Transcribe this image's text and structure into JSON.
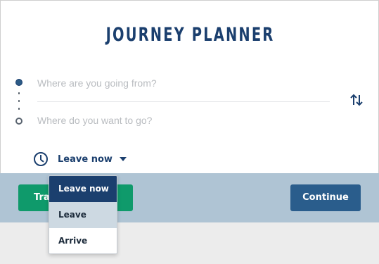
{
  "title": "JOURNEY PLANNER",
  "from": {
    "placeholder": "Where are you going from?"
  },
  "to": {
    "placeholder": "Where do you want to go?"
  },
  "time": {
    "selected": "Leave now",
    "options": [
      "Leave now",
      "Leave",
      "Arrive"
    ]
  },
  "buttons": {
    "left_visible_text": "Tra",
    "continue": "Continue"
  },
  "icons": {
    "swap": "swap-vertical-icon",
    "clock": "clock-icon",
    "caret": "caret-down-icon"
  },
  "colors": {
    "primary": "#1b3f6e",
    "continue": "#2a5d8c",
    "green": "#0f9a6b",
    "bar": "#afc4d4"
  }
}
